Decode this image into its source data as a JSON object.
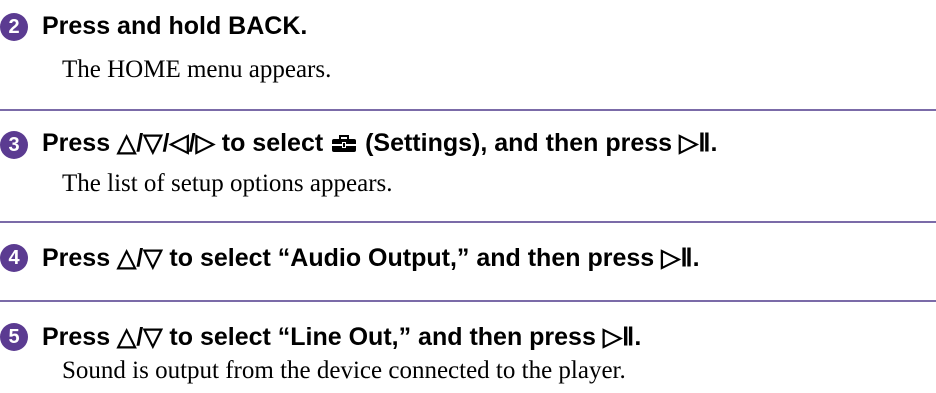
{
  "colors": {
    "accent": "#5b3b91",
    "rule": "#7b6ba8"
  },
  "steps": [
    {
      "number": "2",
      "title": "Press and hold BACK.",
      "description": "The HOME menu appears."
    },
    {
      "number": "3",
      "title_before_icon": "Press △/▽/◁/▷ to select ",
      "icon": "toolbox-settings-icon",
      "title_after_icon": " (Settings), and then press ▷Ⅱ.",
      "description": "The list of setup options appears."
    },
    {
      "number": "4",
      "title": "Press △/▽ to select “Audio Output,” and then press ▷Ⅱ."
    },
    {
      "number": "5",
      "title": "Press △/▽ to select “Line Out,” and then press ▷Ⅱ.",
      "description": "Sound is output from the device connected to the player."
    }
  ]
}
